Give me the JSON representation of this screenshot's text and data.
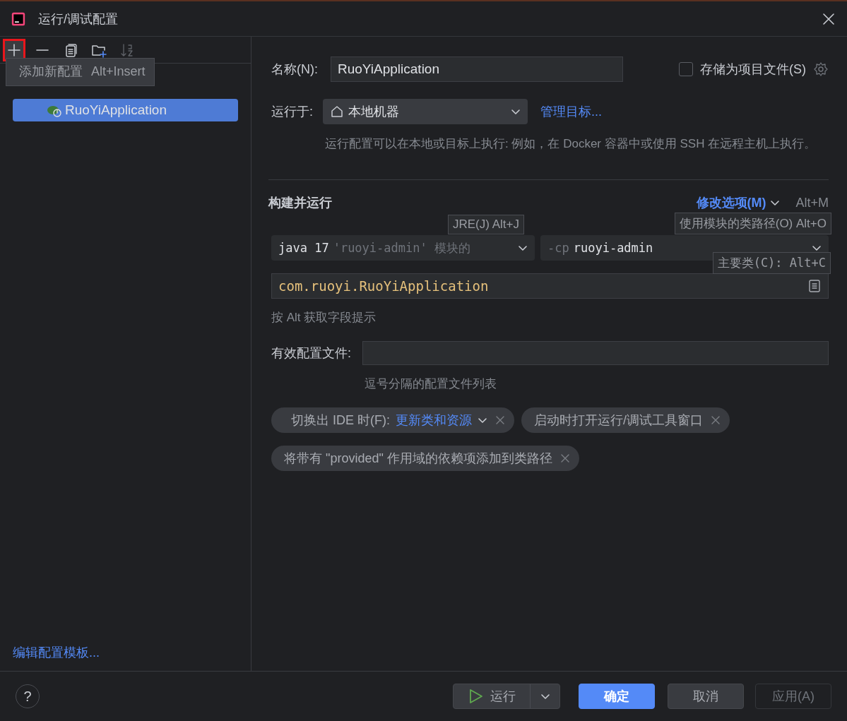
{
  "window": {
    "title": "运行/调试配置"
  },
  "toolbar": [
    {
      "kind": "add",
      "highlighted": true,
      "disabled": false
    },
    {
      "kind": "remove",
      "highlighted": false,
      "disabled": false
    },
    {
      "kind": "copy",
      "highlighted": false,
      "disabled": false
    },
    {
      "kind": "folder",
      "highlighted": false,
      "disabled": false
    },
    {
      "kind": "sort",
      "highlighted": false,
      "disabled": true
    }
  ],
  "tooltip": {
    "text": "添加新配置",
    "shortcut": "Alt+Insert"
  },
  "configurations": [
    {
      "label": "RuoYiApplication",
      "selected": true
    }
  ],
  "sidebar_link": "编辑配置模板...",
  "name": {
    "label": "名称(N):",
    "value": "RuoYiApplication"
  },
  "store": {
    "label": "存储为项目文件(S)",
    "checked": false
  },
  "run_on": {
    "label": "运行于:",
    "value": "本地机器",
    "link": "管理目标...",
    "hint": "运行配置可以在本地或目标上执行: 例如，在 Docker 容器中或使用 SSH 在远程主机上执行。"
  },
  "section": {
    "title": "构建并运行",
    "modify": "修改选项(M)",
    "modify_shortcut": "Alt+M"
  },
  "hints": [
    {
      "kind": "jre",
      "text": "JRE(J) Alt+J"
    },
    {
      "kind": "classpath",
      "text": "使用模块的类路径(O) Alt+O"
    },
    {
      "kind": "main",
      "text": "主要类(C): Alt+C"
    }
  ],
  "jre": {
    "value": "java 17",
    "detail": "'ruoyi-admin' 模块的"
  },
  "classpath": {
    "prefix": "-cp",
    "value": "ruoyi-admin"
  },
  "main_class": "com.ruoyi.RuoYiApplication",
  "alt_hint": "按 Alt 获取字段提示",
  "profiles": {
    "label": "有效配置文件:",
    "hint": "逗号分隔的配置文件列表"
  },
  "chips": [
    {
      "label": "切换出 IDE 时(F):",
      "value": "更新类和资源"
    },
    {
      "label": "启动时打开运行/调试工具窗口"
    },
    {
      "label": "将带有 \"provided\" 作用域的依赖项添加到类路径"
    }
  ],
  "footer": {
    "help": "?",
    "buttons": [
      {
        "kind": "run",
        "label": "运行",
        "disabled": false
      },
      {
        "kind": "primary",
        "label": "确定",
        "disabled": false
      },
      {
        "kind": "default",
        "label": "取消",
        "disabled": false
      },
      {
        "kind": "default",
        "label": "应用(A)",
        "disabled": true
      }
    ]
  }
}
